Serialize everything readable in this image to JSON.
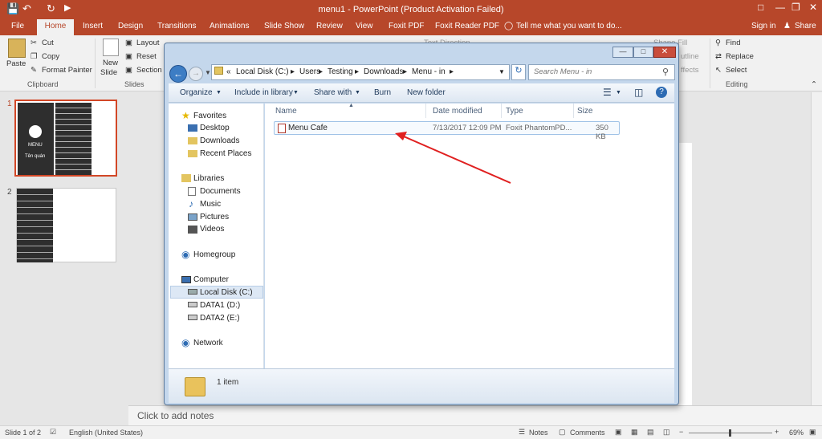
{
  "app": {
    "title": "menu1 - PowerPoint (Product Activation Failed)",
    "tabs": [
      "File",
      "Home",
      "Insert",
      "Design",
      "Transitions",
      "Animations",
      "Slide Show",
      "Review",
      "View",
      "Foxit PDF",
      "Foxit Reader PDF"
    ],
    "tell_me": "Tell me what you want to do...",
    "sign_in": "Sign in",
    "share": "Share"
  },
  "ribbon": {
    "paste": "Paste",
    "cut": "Cut",
    "copy": "Copy",
    "format_painter": "Format Painter",
    "clipboard": "Clipboard",
    "new_slide_1": "New",
    "new_slide_2": "Slide",
    "layout": "Layout",
    "reset": "Reset",
    "section": "Section",
    "slides": "Slides",
    "text_direction": "Text Direction",
    "shape_fill": "Shape Fill",
    "outline": "utline",
    "effects": "ffects",
    "find": "Find",
    "replace": "Replace",
    "select": "Select",
    "editing": "Editing"
  },
  "thumbnails": [
    {
      "num": "1",
      "menu": "MENU",
      "name": "Tên quán"
    },
    {
      "num": "2"
    }
  ],
  "notes_placeholder": "Click to add notes",
  "status": {
    "slide_count": "Slide 1 of 2",
    "language": "English (United States)",
    "notes": "Notes",
    "comments": "Comments",
    "zoom": "69%"
  },
  "explorer": {
    "breadcrumb": [
      "Local Disk (C:)",
      "Users",
      "Testing",
      "Downloads",
      "Menu - in"
    ],
    "breadcrumb_prefix": "«",
    "search_placeholder": "Search Menu - in",
    "commands": [
      "Organize",
      "Include in library",
      "Share with",
      "Burn",
      "New folder"
    ],
    "nav": {
      "favorites": "Favorites",
      "desktop": "Desktop",
      "downloads": "Downloads",
      "recent": "Recent Places",
      "libraries": "Libraries",
      "documents": "Documents",
      "music": "Music",
      "pictures": "Pictures",
      "videos": "Videos",
      "homegroup": "Homegroup",
      "computer": "Computer",
      "local_disk": "Local Disk (C:)",
      "data1": "DATA1 (D:)",
      "data2": "DATA2 (E:)",
      "network": "Network"
    },
    "columns": {
      "name": "Name",
      "date": "Date modified",
      "type": "Type",
      "size": "Size"
    },
    "files": [
      {
        "name": "Menu Cafe",
        "date": "7/13/2017 12:09 PM",
        "type": "Foxit PhantomPD...",
        "size": "350 KB"
      }
    ],
    "item_count": "1 item"
  },
  "colors": {
    "accent": "#b7472a",
    "arrow": "#e02020"
  }
}
